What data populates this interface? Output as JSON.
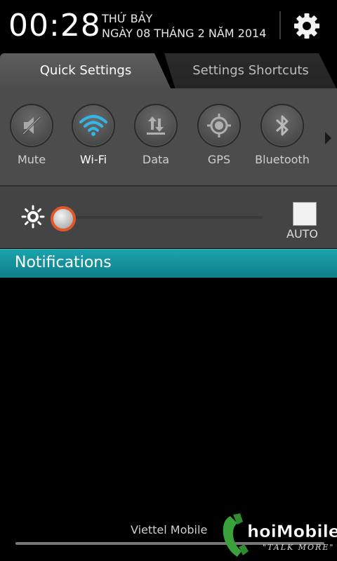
{
  "header": {
    "time": "00:28",
    "day": "THỨ BẢY",
    "date": "NGÀY 08 THÁNG 2 NĂM 2014"
  },
  "tabs": [
    {
      "label": "Quick Settings",
      "active": true
    },
    {
      "label": "Settings Shortcuts",
      "active": false
    }
  ],
  "toggles": [
    {
      "label": "Mute",
      "icon": "mute-icon",
      "on": false
    },
    {
      "label": "Wi-Fi",
      "icon": "wifi-icon",
      "on": true
    },
    {
      "label": "Data",
      "icon": "data-icon",
      "on": false
    },
    {
      "label": "GPS",
      "icon": "gps-icon",
      "on": false
    },
    {
      "label": "Bluetooth",
      "icon": "bluetooth-icon",
      "on": false
    }
  ],
  "brightness": {
    "level": 0.0,
    "auto_label": "AUTO",
    "auto_checked": false
  },
  "notifications": {
    "title": "Notifications"
  },
  "carrier": "Viettel Mobile",
  "watermark": {
    "brand": "ChoiMobile",
    "tagline": "TALK MORE"
  },
  "colors": {
    "accent_teal": "#1aa3ad",
    "wifi_on": "#33b5e5",
    "slider_thumb_ring": "#e0582a"
  }
}
